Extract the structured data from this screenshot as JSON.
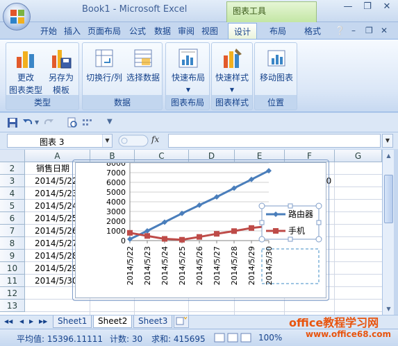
{
  "window": {
    "title": "Book1 - Microsoft Excel",
    "tool_context": "图表工具"
  },
  "tabs": [
    "开始",
    "插入",
    "页面布局",
    "公式",
    "数据",
    "审阅",
    "视图",
    "设计",
    "布局",
    "格式"
  ],
  "active_tab": "设计",
  "ribbon": {
    "groups": [
      {
        "name": "类型",
        "buttons": [
          "更改\n图表类型",
          "另存为\n模板"
        ]
      },
      {
        "name": "数据",
        "buttons": [
          "切换行/列",
          "选择数据"
        ]
      },
      {
        "name": "图表布局",
        "buttons": [
          "快速布局"
        ]
      },
      {
        "name": "图表样式",
        "buttons": [
          "快速样式"
        ]
      },
      {
        "name": "位置",
        "buttons": [
          "移动图表"
        ]
      }
    ],
    "type_btn1_l1": "更改",
    "type_btn1_l2": "图表类型",
    "type_btn2_l1": "另存为",
    "type_btn2_l2": "模板",
    "data_btn1": "切换行/列",
    "data_btn2": "选择数据",
    "layout_btn": "快速布局",
    "style_btn": "快速样式",
    "move_btn": "移动图表",
    "group_type": "类型",
    "group_data": "数据",
    "group_layout": "图表布局",
    "group_style": "图表样式",
    "group_pos": "位置"
  },
  "formula_bar": {
    "name_box": "图表 3",
    "fx_label": "fx",
    "formula": ""
  },
  "grid": {
    "columns": [
      "A",
      "B",
      "C",
      "D",
      "E",
      "F",
      "G"
    ],
    "rows": [
      "2",
      "3",
      "4",
      "5",
      "6",
      "7",
      "8",
      "9",
      "10",
      "11",
      "12",
      "13"
    ],
    "cells": {
      "A2": "销售日期",
      "A3": "2014/5/22",
      "A4": "2014/5/23",
      "A5": "2014/5/24",
      "A6": "2014/5/25",
      "A7": "2014/5/26",
      "A8": "2014/5/27",
      "A9": "2014/5/28",
      "A10": "2014/5/29",
      "A11": "2014/5/30",
      "F3": "20"
    }
  },
  "chart_data": {
    "type": "line",
    "title": "",
    "xlabel": "",
    "ylabel": "",
    "categories": [
      "2014/5/22",
      "2014/5/23",
      "2014/5/24",
      "2014/5/25",
      "2014/5/26",
      "2014/5/27",
      "2014/5/28",
      "2014/5/29",
      "2014/5/30"
    ],
    "series": [
      {
        "name": "路由器",
        "color": "#4a7ebb",
        "marker": "diamond",
        "values": [
          150,
          1000,
          1900,
          2800,
          3650,
          4500,
          5400,
          6300,
          7200
        ]
      },
      {
        "name": "手机",
        "color": "#be4b48",
        "marker": "square",
        "values": [
          800,
          480,
          180,
          90,
          380,
          700,
          980,
          1300,
          1500
        ]
      }
    ],
    "ylim": [
      0,
      8000
    ],
    "yticks": [
      0,
      1000,
      2000,
      3000,
      4000,
      5000,
      6000,
      7000,
      8000
    ],
    "ytick_labels": [
      "0",
      "1000",
      "2000",
      "3000",
      "4000",
      "5000",
      "6000",
      "7000",
      "8000"
    ],
    "grid": true,
    "legend": "right"
  },
  "sheets": [
    "Sheet1",
    "Sheet2",
    "Sheet3"
  ],
  "active_sheet": "Sheet2",
  "status": {
    "average": "平均值: 15396.11111",
    "count": "计数: 30",
    "sum": "求和: 415695",
    "zoom": "100%"
  },
  "watermark": {
    "line1": "office教程学习网",
    "line2": "www.office68.com"
  }
}
